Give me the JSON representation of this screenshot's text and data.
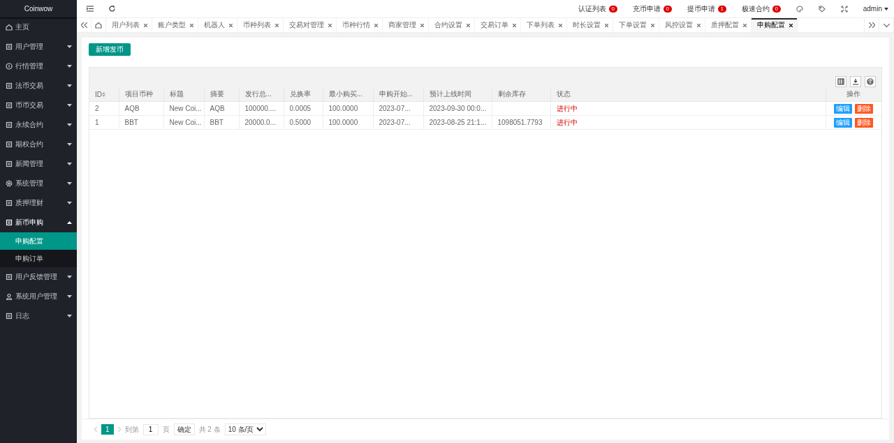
{
  "sidebar": {
    "logo": "Coinwow",
    "items": [
      {
        "label": "主页"
      },
      {
        "label": "用户管理",
        "expanded": false
      },
      {
        "label": "行情管理",
        "expanded": false
      },
      {
        "label": "法币交易",
        "expanded": false
      },
      {
        "label": "币币交易",
        "expanded": false
      },
      {
        "label": "永续合约",
        "expanded": false
      },
      {
        "label": "期权合约",
        "expanded": false
      },
      {
        "label": "新闻管理",
        "expanded": false
      },
      {
        "label": "系统管理",
        "expanded": false
      },
      {
        "label": "质押理财",
        "expanded": false
      },
      {
        "label": "新币申购",
        "expanded": true,
        "children": [
          {
            "label": "申购配置",
            "selected": true
          },
          {
            "label": "申购订单",
            "selected": false
          }
        ]
      },
      {
        "label": "用户反馈管理",
        "expanded": false
      },
      {
        "label": "系统用户管理",
        "expanded": false
      },
      {
        "label": "日志",
        "expanded": false
      }
    ]
  },
  "header": {
    "notices": [
      {
        "label": "认证列表",
        "count": "0"
      },
      {
        "label": "充币申请",
        "count": "0"
      },
      {
        "label": "提币申请",
        "count": "1"
      },
      {
        "label": "极速合约",
        "count": "0"
      }
    ],
    "user": "admin"
  },
  "tabs": [
    {
      "label": "用户列表",
      "selected": false
    },
    {
      "label": "账户类型",
      "selected": false
    },
    {
      "label": "机器人",
      "selected": false
    },
    {
      "label": "币种列表",
      "selected": false
    },
    {
      "label": "交易对管理",
      "selected": false
    },
    {
      "label": "币种行情",
      "selected": false
    },
    {
      "label": "商家管理",
      "selected": false
    },
    {
      "label": "合约设置",
      "selected": false
    },
    {
      "label": "交易订单",
      "selected": false
    },
    {
      "label": "下单列表",
      "selected": false
    },
    {
      "label": "时长设置",
      "selected": false
    },
    {
      "label": "下单设置",
      "selected": false
    },
    {
      "label": "风控设置",
      "selected": false
    },
    {
      "label": "质押配置",
      "selected": false
    },
    {
      "label": "申购配置",
      "selected": true
    }
  ],
  "add_button": "新增发币",
  "table": {
    "columns": [
      "ID",
      "项目币种",
      "标题",
      "摘要",
      "发行总...",
      "兑换率",
      "最小购买...",
      "申购开始...",
      "预计上线时间",
      "剩余库存",
      "状态",
      "操作"
    ],
    "rows": [
      {
        "cells": [
          "2",
          "AQB",
          "New Coi...",
          "AQB",
          "100000....",
          "0.0005",
          "100.0000",
          "2023-07...",
          "2023-09-30 00:0...",
          null,
          "进行中"
        ],
        "actions": [
          "编辑",
          "删除"
        ]
      },
      {
        "cells": [
          "1",
          "BBT",
          "New Coi...",
          "BBT",
          "20000.0...",
          "0.5000",
          "100.0000",
          "2023-07...",
          "2023-08-25 21:1...",
          "1098051.7793",
          "进行中"
        ],
        "actions": [
          "编辑",
          "删除"
        ]
      }
    ]
  },
  "pagination": {
    "pages": [
      {
        "label": "1",
        "selected": true
      }
    ],
    "goto_label": "到第",
    "goto_value": "1",
    "page_word": "页",
    "confirm": "确定",
    "total": "共 2 条",
    "page_size": "10 条/页"
  }
}
